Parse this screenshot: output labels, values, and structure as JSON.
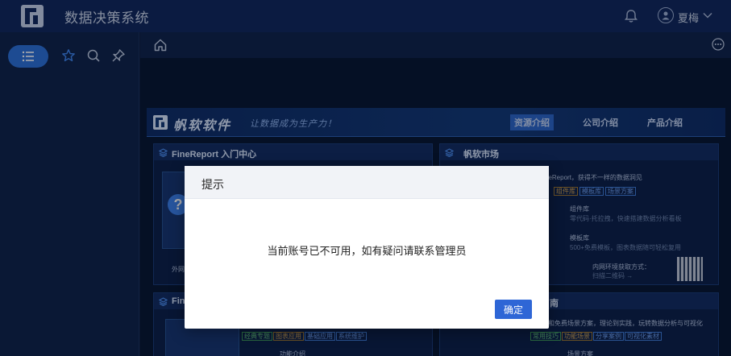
{
  "app": {
    "title": "数据决策系统"
  },
  "user": {
    "name": "夏梅"
  },
  "dashboard": {
    "brand": "帆软软件",
    "slogan": "让数据成为生产力！",
    "tabs": [
      "资源介绍",
      "公司介绍",
      "产品介绍"
    ],
    "active_tab": "资源介绍",
    "panels": {
      "finereport": {
        "title": "FineReport 入门中心",
        "foot": "外网"
      },
      "market": {
        "title": "帆软市场",
        "intro": "nceReport，获得不一样的数据洞见",
        "tags": [
          "组件库",
          "模板库",
          "场景方案"
        ],
        "items": [
          {
            "name": "组件库",
            "desc": "零代码·托拉拽，快速搭建数据分析看板"
          },
          {
            "name": "模板库",
            "desc": "500+免费模板，图表数据随可轻松复用"
          }
        ],
        "env_label": "内网环境获取方式：",
        "env_sub": "扫描二维码 →"
      },
      "second": {
        "title_fragment": "Fin",
        "tags": [
          "经典专题",
          "图表应用",
          "基础应用",
          "系统维护"
        ],
        "sub": "功能介绍"
      },
      "guide": {
        "title_fragment": "南",
        "desc": "和方法和免费场景方案，理论到实践，玩转数据分析与可视化",
        "tags": [
          "常用技巧",
          "功能场景",
          "分享案例",
          "可视化素材"
        ],
        "sub": "场景方案"
      }
    }
  },
  "dialog": {
    "title": "提示",
    "message": "当前账号已不可用，如有疑问请联系管理员",
    "ok_label": "确定"
  },
  "colors": {
    "topbar": "#10265a",
    "accent": "#2e66d6",
    "content_bg": "#07142f"
  }
}
